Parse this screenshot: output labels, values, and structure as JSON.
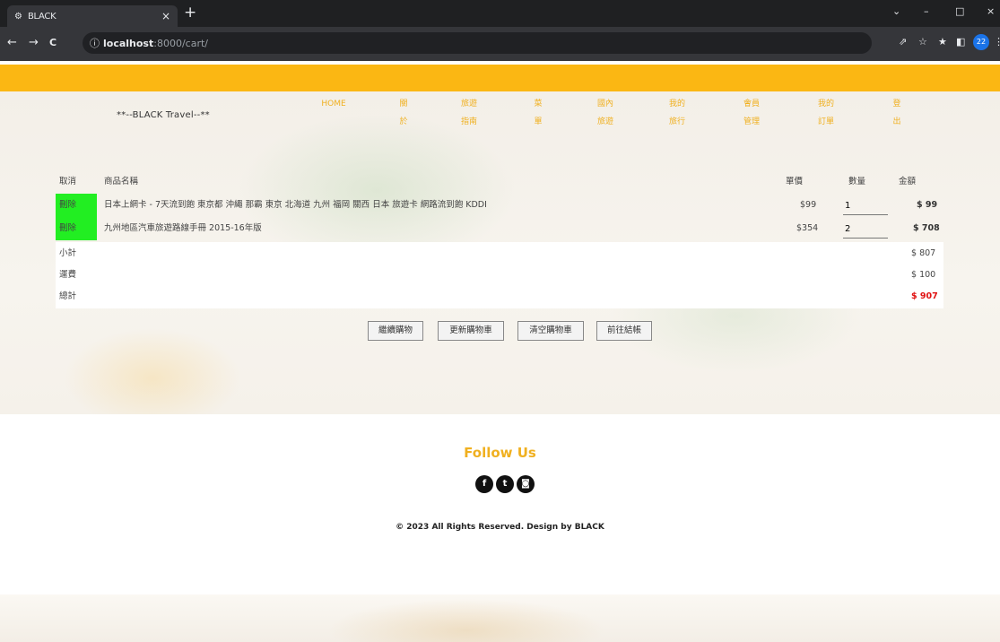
{
  "browser": {
    "tab_title": "BLACK",
    "tab_icon": "⚙",
    "close": "×",
    "new_tab": "+",
    "url_host": "localhost",
    "url_path": ":8000/cart/",
    "info": "ⓘ",
    "window": {
      "chevron": "⌄",
      "min": "–",
      "max": "□",
      "close": "×"
    },
    "nav": {
      "back": "←",
      "forward": "→",
      "reload": "C"
    },
    "tools": {
      "share": "⇗",
      "star": "☆",
      "ext": "★",
      "sidepanel": "◧",
      "profile": "22"
    },
    "menu": "⋮"
  },
  "site": {
    "brand": "**--BLACK Travel--**",
    "menu": [
      {
        "label": "HOME"
      },
      {
        "label": "關\n於"
      },
      {
        "label": "旅遊\n指南"
      },
      {
        "label": "菜\n單"
      },
      {
        "label": "國內\n旅遊"
      },
      {
        "label": "我的\n旅行"
      },
      {
        "label": "會員\n管理"
      },
      {
        "label": "我的\n訂單"
      },
      {
        "label": "登\n出"
      }
    ]
  },
  "cart": {
    "headers": {
      "remove": "取消",
      "name": "商品名稱",
      "price": "單價",
      "qty": "數量",
      "amount": "金額"
    },
    "items": [
      {
        "remove": "刪除",
        "name": "日本上網卡 - 7天流到飽 東京都 沖繩 那霸 東京 北海道 九州 福岡 關西 日本 旅遊卡 網路流到飽 KDDI",
        "price": "$99",
        "qty": "1",
        "amount": "$ 99"
      },
      {
        "remove": "刪除",
        "name": "九州地區汽車旅遊路線手冊 2015-16年版",
        "price": "$354",
        "qty": "2",
        "amount": "$ 708"
      }
    ],
    "summary": [
      {
        "label": "小計",
        "value": "$ 807"
      },
      {
        "label": "運費",
        "value": "$ 100"
      },
      {
        "label": "總計",
        "value": "$ 907"
      }
    ]
  },
  "actions": {
    "continue": "繼續購物",
    "update": "更新購物車",
    "clear": "清空購物車",
    "checkout": "前往結帳"
  },
  "footer": {
    "follow": "Follow Us",
    "social": {
      "facebook": "f",
      "twitter": "t",
      "instagram": "◙"
    },
    "copyright": "© 2023 All Rights Reserved. Design by BLACK"
  }
}
